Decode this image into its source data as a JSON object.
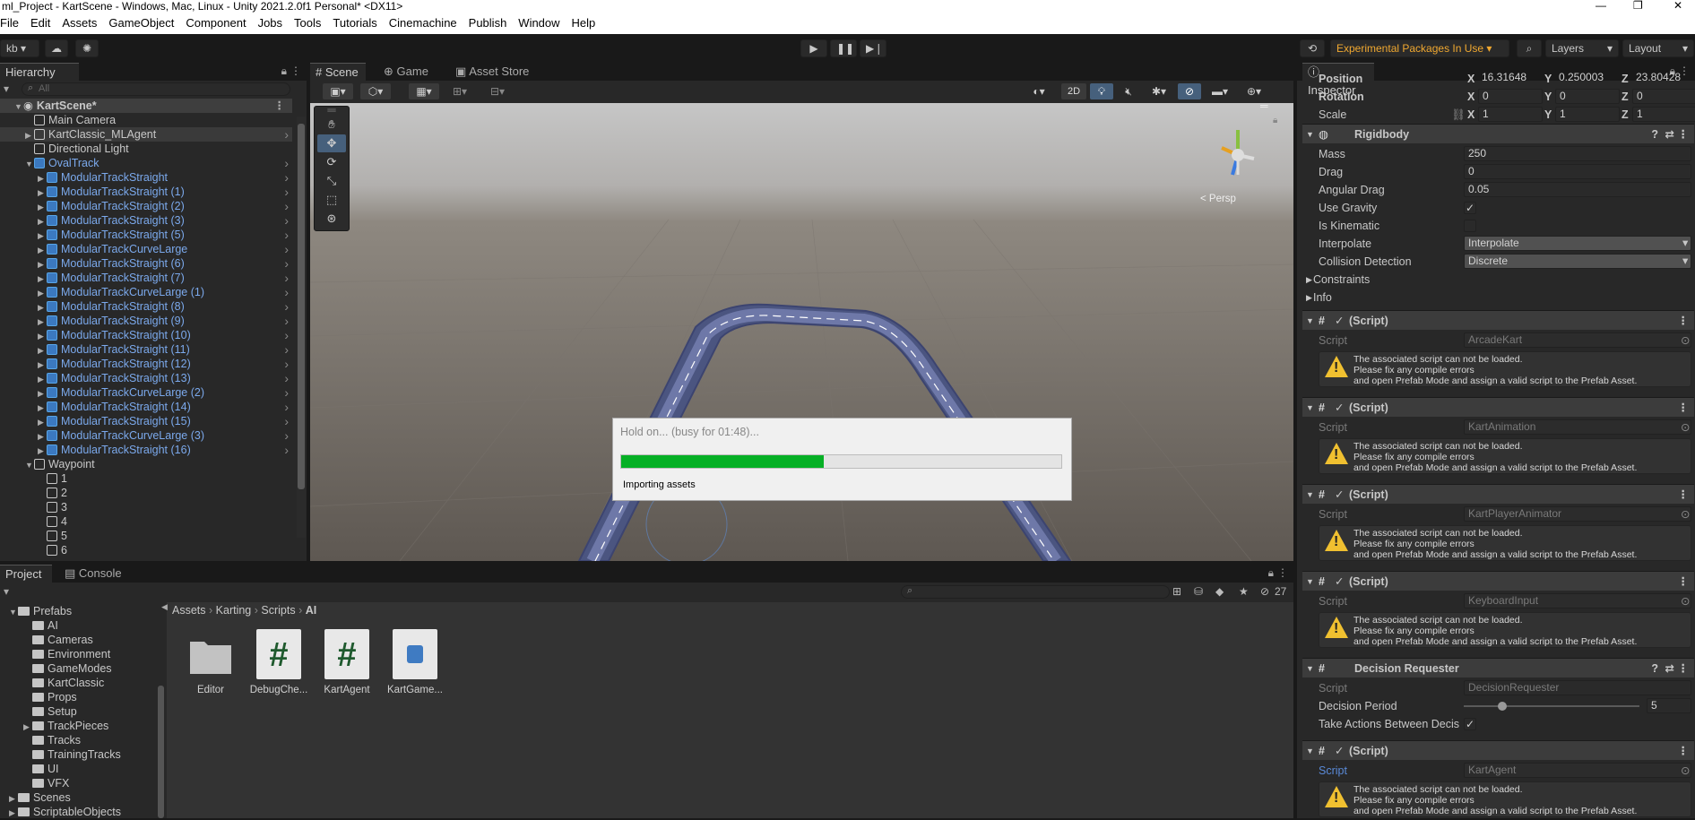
{
  "window": {
    "title": "ml_Project - KartScene - Windows, Mac, Linux - Unity 2021.2.0f1 Personal* <DX11>"
  },
  "menu": [
    "File",
    "Edit",
    "Assets",
    "GameObject",
    "Component",
    "Jobs",
    "Tools",
    "Tutorials",
    "Cinemachine",
    "Publish",
    "Window",
    "Help"
  ],
  "toolbar": {
    "account": "kb",
    "experimental": "Experimental Packages In Use",
    "layers": "Layers",
    "layout": "Layout"
  },
  "hierarchy": {
    "tab": "Hierarchy",
    "search_placeholder": "All",
    "scene": "KartScene*",
    "items": [
      {
        "label": "Main Camera",
        "blue": false,
        "indent": 1,
        "exp": ""
      },
      {
        "label": "KartClassic_MLAgent",
        "blue": false,
        "indent": 1,
        "exp": "▶",
        "arrow": true
      },
      {
        "label": "Directional Light",
        "blue": false,
        "indent": 1,
        "exp": ""
      },
      {
        "label": "OvalTrack",
        "blue": true,
        "indent": 1,
        "exp": "▼",
        "arrow": true
      },
      {
        "label": "ModularTrackStraight",
        "blue": true,
        "indent": 2,
        "exp": "▶",
        "arrow": true
      },
      {
        "label": "ModularTrackStraight (1)",
        "blue": true,
        "indent": 2,
        "exp": "▶",
        "arrow": true
      },
      {
        "label": "ModularTrackStraight (2)",
        "blue": true,
        "indent": 2,
        "exp": "▶",
        "arrow": true
      },
      {
        "label": "ModularTrackStraight (3)",
        "blue": true,
        "indent": 2,
        "exp": "▶",
        "arrow": true
      },
      {
        "label": "ModularTrackStraight (5)",
        "blue": true,
        "indent": 2,
        "exp": "▶",
        "arrow": true
      },
      {
        "label": "ModularTrackCurveLarge",
        "blue": true,
        "indent": 2,
        "exp": "▶",
        "arrow": true
      },
      {
        "label": "ModularTrackStraight (6)",
        "blue": true,
        "indent": 2,
        "exp": "▶",
        "arrow": true
      },
      {
        "label": "ModularTrackStraight (7)",
        "blue": true,
        "indent": 2,
        "exp": "▶",
        "arrow": true
      },
      {
        "label": "ModularTrackCurveLarge (1)",
        "blue": true,
        "indent": 2,
        "exp": "▶",
        "arrow": true
      },
      {
        "label": "ModularTrackStraight (8)",
        "blue": true,
        "indent": 2,
        "exp": "▶",
        "arrow": true
      },
      {
        "label": "ModularTrackStraight (9)",
        "blue": true,
        "indent": 2,
        "exp": "▶",
        "arrow": true
      },
      {
        "label": "ModularTrackStraight (10)",
        "blue": true,
        "indent": 2,
        "exp": "▶",
        "arrow": true
      },
      {
        "label": "ModularTrackStraight (11)",
        "blue": true,
        "indent": 2,
        "exp": "▶",
        "arrow": true
      },
      {
        "label": "ModularTrackStraight (12)",
        "blue": true,
        "indent": 2,
        "exp": "▶",
        "arrow": true
      },
      {
        "label": "ModularTrackStraight (13)",
        "blue": true,
        "indent": 2,
        "exp": "▶",
        "arrow": true
      },
      {
        "label": "ModularTrackCurveLarge (2)",
        "blue": true,
        "indent": 2,
        "exp": "▶",
        "arrow": true
      },
      {
        "label": "ModularTrackStraight (14)",
        "blue": true,
        "indent": 2,
        "exp": "▶",
        "arrow": true
      },
      {
        "label": "ModularTrackStraight (15)",
        "blue": true,
        "indent": 2,
        "exp": "▶",
        "arrow": true
      },
      {
        "label": "ModularTrackCurveLarge (3)",
        "blue": true,
        "indent": 2,
        "exp": "▶",
        "arrow": true
      },
      {
        "label": "ModularTrackStraight (16)",
        "blue": true,
        "indent": 2,
        "exp": "▶",
        "arrow": true
      },
      {
        "label": "Waypoint",
        "blue": false,
        "indent": 1,
        "exp": "▼"
      },
      {
        "label": "1",
        "blue": false,
        "indent": 2,
        "exp": ""
      },
      {
        "label": "2",
        "blue": false,
        "indent": 2,
        "exp": ""
      },
      {
        "label": "3",
        "blue": false,
        "indent": 2,
        "exp": ""
      },
      {
        "label": "4",
        "blue": false,
        "indent": 2,
        "exp": ""
      },
      {
        "label": "5",
        "blue": false,
        "indent": 2,
        "exp": ""
      },
      {
        "label": "6",
        "blue": false,
        "indent": 2,
        "exp": ""
      }
    ]
  },
  "scene_tabs": [
    "Scene",
    "Game",
    "Asset Store"
  ],
  "scene_view": {
    "persp": "< Persp",
    "mode2d": "2D"
  },
  "dialog": {
    "title": "Hold on... (busy for 01:48)...",
    "message": "Importing assets",
    "progress": 0.46
  },
  "inspector": {
    "tab": "Inspector",
    "transform": {
      "position": {
        "label": "Position",
        "x": "16.31648",
        "y": "0.250003",
        "z": "23.80428"
      },
      "rotation": {
        "label": "Rotation",
        "x": "0",
        "y": "0",
        "z": "0"
      },
      "scale": {
        "label": "Scale",
        "x": "1",
        "y": "1",
        "z": "1"
      }
    },
    "rigidbody": {
      "title": "Rigidbody",
      "mass": {
        "label": "Mass",
        "value": "250"
      },
      "drag": {
        "label": "Drag",
        "value": "0"
      },
      "angular_drag": {
        "label": "Angular Drag",
        "value": "0.05"
      },
      "use_gravity": {
        "label": "Use Gravity",
        "checked": "✓"
      },
      "is_kinematic": {
        "label": "Is Kinematic",
        "checked": ""
      },
      "interpolate": {
        "label": "Interpolate",
        "value": "Interpolate"
      },
      "collision": {
        "label": "Collision Detection",
        "value": "Discrete"
      },
      "constraints": "Constraints",
      "info": "Info"
    },
    "script_label": "Script",
    "script_title": "(Script)",
    "warn_lines": [
      "The associated script can not be loaded.",
      "Please fix any compile errors",
      "and open Prefab Mode and assign a valid script to the Prefab Asset."
    ],
    "scripts": [
      "ArcadeKart",
      "KartAnimation",
      "KartPlayerAnimator",
      "KeyboardInput"
    ],
    "decision": {
      "title": "Decision Requester",
      "script": "DecisionRequester",
      "period_label": "Decision Period",
      "period_value": "5",
      "period_fraction": 0.22,
      "take_label": "Take Actions Between Decis",
      "take_checked": "✓"
    },
    "last_script": "KartAgent"
  },
  "project": {
    "tabs": [
      "Project",
      "Console"
    ],
    "hidden_count": "27",
    "breadcrumb": [
      "Assets",
      "Karting",
      "Scripts",
      "AI"
    ],
    "tree": [
      {
        "label": "Prefabs",
        "indent": 1,
        "exp": "▼"
      },
      {
        "label": "AI",
        "indent": 2,
        "exp": ""
      },
      {
        "label": "Cameras",
        "indent": 2,
        "exp": ""
      },
      {
        "label": "Environment",
        "indent": 2,
        "exp": ""
      },
      {
        "label": "GameModes",
        "indent": 2,
        "exp": ""
      },
      {
        "label": "KartClassic",
        "indent": 2,
        "exp": ""
      },
      {
        "label": "Props",
        "indent": 2,
        "exp": ""
      },
      {
        "label": "Setup",
        "indent": 2,
        "exp": ""
      },
      {
        "label": "TrackPieces",
        "indent": 2,
        "exp": "▶"
      },
      {
        "label": "Tracks",
        "indent": 2,
        "exp": ""
      },
      {
        "label": "TrainingTracks",
        "indent": 2,
        "exp": ""
      },
      {
        "label": "UI",
        "indent": 2,
        "exp": ""
      },
      {
        "label": "VFX",
        "indent": 2,
        "exp": ""
      },
      {
        "label": "Scenes",
        "indent": 1,
        "exp": "▶"
      },
      {
        "label": "ScriptableObjects",
        "indent": 1,
        "exp": "▶"
      }
    ],
    "files": [
      {
        "label": "Editor",
        "kind": "folder"
      },
      {
        "label": "DebugChe...",
        "kind": "cs"
      },
      {
        "label": "KartAgent",
        "kind": "cs"
      },
      {
        "label": "KartGame...",
        "kind": "asm"
      }
    ]
  }
}
